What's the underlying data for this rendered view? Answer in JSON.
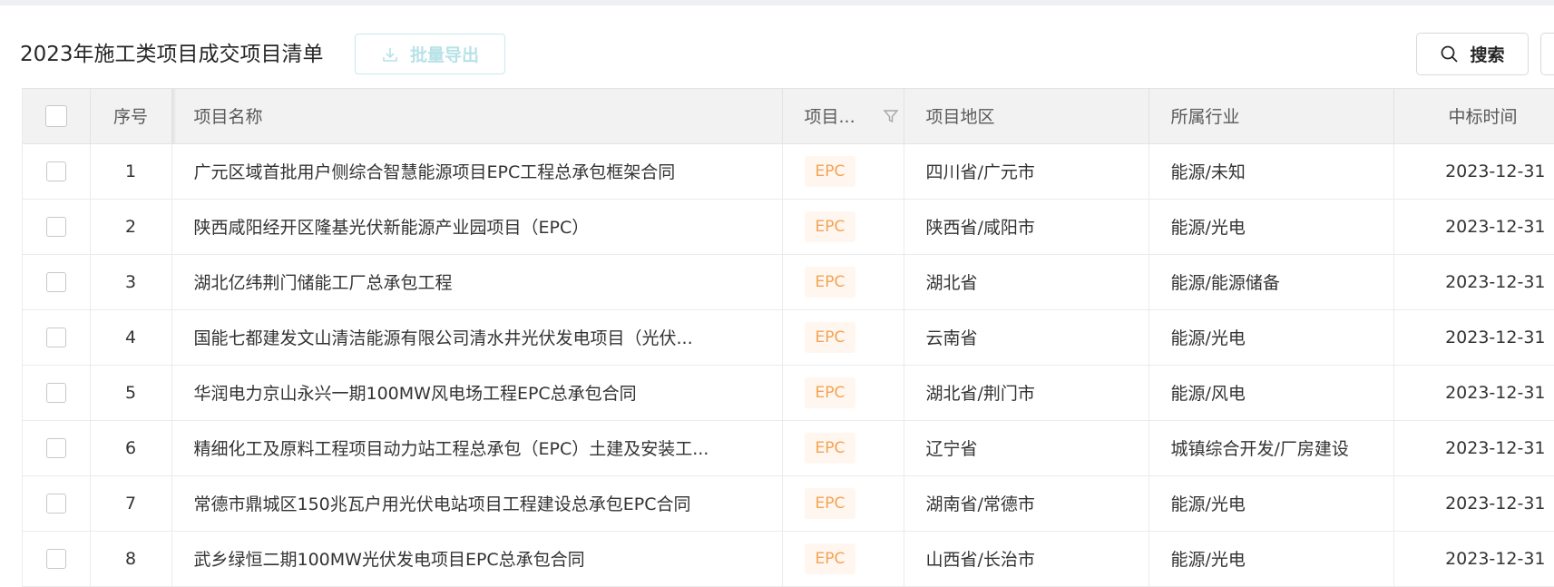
{
  "page": {
    "title": "2023年施工类项目成交项目清单",
    "export_label": "批量导出",
    "search_label": "搜索"
  },
  "colors": {
    "accent_light": "#b7e2e8",
    "badge_text": "#f5a254",
    "badge_bg": "#fff7ef",
    "header_bg": "#f2f2f2"
  },
  "icons": {
    "export": "download-icon",
    "search": "search-icon",
    "filter": "filter-icon"
  },
  "table": {
    "columns": {
      "seq": "序号",
      "name": "项目名称",
      "type": "项目...",
      "region": "项目地区",
      "industry": "所属行业",
      "time": "中标时间"
    },
    "rows": [
      {
        "seq": "1",
        "name": "广元区域首批用户侧综合智慧能源项目EPC工程总承包框架合同",
        "type": "EPC",
        "region": "四川省/广元市",
        "industry": "能源/未知",
        "time": "2023-12-31"
      },
      {
        "seq": "2",
        "name": "陕西咸阳经开区隆基光伏新能源产业园项目（EPC）",
        "type": "EPC",
        "region": "陕西省/咸阳市",
        "industry": "能源/光电",
        "time": "2023-12-31"
      },
      {
        "seq": "3",
        "name": "湖北亿纬荆门储能工厂总承包工程",
        "type": "EPC",
        "region": "湖北省",
        "industry": "能源/能源储备",
        "time": "2023-12-31"
      },
      {
        "seq": "4",
        "name": "国能七都建发文山清洁能源有限公司清水井光伏发电项目（光伏...",
        "type": "EPC",
        "region": "云南省",
        "industry": "能源/光电",
        "time": "2023-12-31"
      },
      {
        "seq": "5",
        "name": "华润电力京山永兴一期100MW风电场工程EPC总承包合同",
        "type": "EPC",
        "region": "湖北省/荆门市",
        "industry": "能源/风电",
        "time": "2023-12-31"
      },
      {
        "seq": "6",
        "name": "精细化工及原料工程项目动力站工程总承包（EPC）土建及安装工...",
        "type": "EPC",
        "region": "辽宁省",
        "industry": "城镇综合开发/厂房建设",
        "time": "2023-12-31"
      },
      {
        "seq": "7",
        "name": "常德市鼎城区150兆瓦户用光伏电站项目工程建设总承包EPC合同",
        "type": "EPC",
        "region": "湖南省/常德市",
        "industry": "能源/光电",
        "time": "2023-12-31"
      },
      {
        "seq": "8",
        "name": "武乡绿恒二期100MW光伏发电项目EPC总承包合同",
        "type": "EPC",
        "region": "山西省/长治市",
        "industry": "能源/光电",
        "time": "2023-12-31"
      }
    ]
  }
}
